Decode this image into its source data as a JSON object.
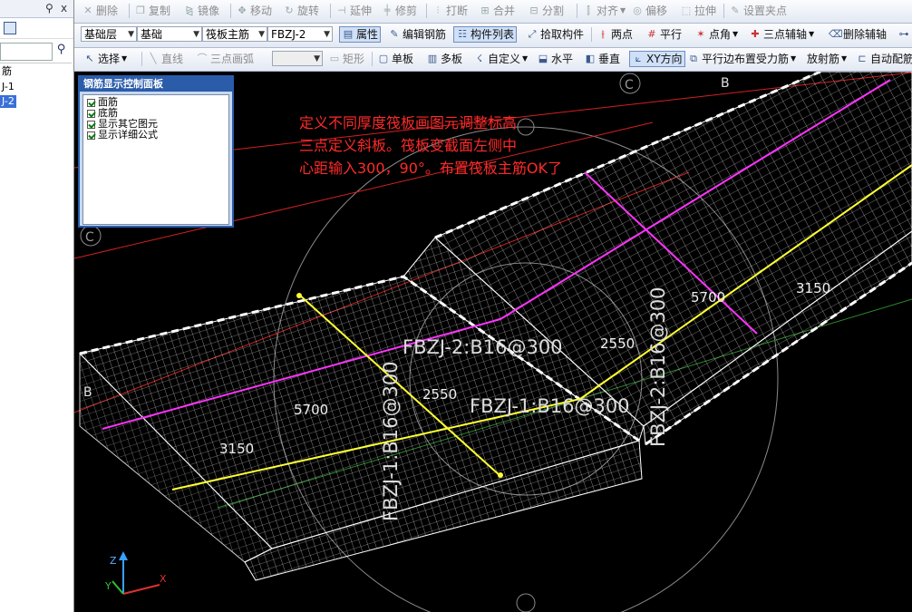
{
  "left_panel": {
    "pin_icon": "pin-icon",
    "close_label": "x",
    "items": [
      {
        "label": "筋",
        "selected": false
      },
      {
        "label": "J-1",
        "selected": false
      },
      {
        "label": "J-2",
        "selected": true
      }
    ]
  },
  "toolbar1": {
    "delete": "删除",
    "copy": "复制",
    "mirror": "镜像",
    "move": "移动",
    "rotate": "旋转",
    "extend": "延伸",
    "trim": "修剪",
    "break": "打断",
    "merge": "合并",
    "split": "分割",
    "align": "对齐",
    "offset": "偏移",
    "stretch": "拉伸",
    "set_grip": "设置夹点"
  },
  "toolbar2": {
    "floor": "基础层",
    "category": "基础",
    "element_type": "筏板主筋",
    "element": "FBZJ-2",
    "properties": "属性",
    "edit_rebar": "编辑钢筋",
    "element_list": "构件列表",
    "pick": "拾取构件",
    "two_points": "两点",
    "parallel": "平行",
    "point_angle": "点角",
    "three_point_axis": "三点辅轴",
    "delete_axis": "删除辅轴"
  },
  "toolbar3": {
    "select": "选择",
    "line": "直线",
    "arc": "三点画弧",
    "combo_value": "",
    "rect": "矩形",
    "single_plate": "单板",
    "multi_plate": "多板",
    "custom": "自定义",
    "horizontal": "水平",
    "vertical": "垂直",
    "xy_direction": "XY方向",
    "parallel_edge": "平行边布置受力筋",
    "radial": "放射筋",
    "auto_config": "自动配筋"
  },
  "rebar_panel": {
    "title": "钢筋显示控制面板",
    "options": [
      "面筋",
      "底筋",
      "显示其它图元",
      "显示详细公式"
    ]
  },
  "annotation": {
    "line1": "定义不同厚度筏板画图元调整标高",
    "line2": "三点定义斜板。筏板变截面左侧中",
    "line3": "心距输入300，90°。布置筏板主筋OK了"
  },
  "drawing": {
    "labels": {
      "fbzj2_h": "FBZJ-2:B16@300",
      "fbzj1_h": "FBZJ-1:B16@300",
      "fbzj1_v": "FBZJ-1:B16@300",
      "fbzj2_v": "FBZJ-2:B16@300",
      "dim_5700_a": "5700",
      "dim_3150_a": "3150",
      "dim_2550_a": "2550",
      "dim_5700_b": "5700",
      "dim_3150_b": "3150",
      "dim_2550_b": "2550",
      "axis_b_left": "B",
      "axis_b_right": "B",
      "axis_c_top": "C",
      "axis_c_left": "C"
    },
    "axes": {
      "x": "X",
      "y": "Y",
      "z": "Z"
    },
    "colors": {
      "slab": "#ffffff",
      "face_rebar": "#ff33ff",
      "bottom_rebar": "#ffff33",
      "axis_line": "#e02020",
      "grid": "#e8e8e8"
    }
  }
}
